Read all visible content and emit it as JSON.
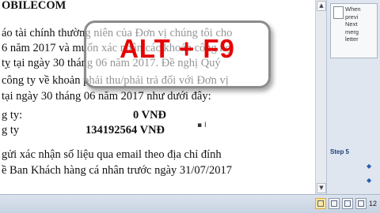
{
  "document": {
    "lines": [
      "OBILECOM",
      "áo tài chính thường niên của Đơn vị chúng tôi cho",
      "6 năm 2017 và muốn xác nhận các khoản công nợ",
      "tỵ tại ngày 30 tháng 06 năm 2017. Đề nghị Quý",
      "công ty về khoản phải thu/phải trả đối với Đơn vị",
      "tại ngày 30 tháng 06 năm 2017 như dưới đây:",
      "g ty:",
      "0  VNĐ",
      "g ty",
      "134192564  VNĐ",
      "gửi  xác nhận số liệu qua email theo địa chỉ đính",
      "ề Ban Khách hàng cá nhân trước ngày 31/07/2017"
    ]
  },
  "overlay": {
    "shortcut": "ALT + F9"
  },
  "task_pane": {
    "preview_text_lines": [
      "When",
      "previ",
      "Next",
      "merg",
      "letter"
    ],
    "step_label": "Step 5"
  },
  "status_bar": {
    "zoom_label": "12"
  },
  "colors": {
    "overlay_text": "#e60000",
    "pane_bg": "#dfe6f0",
    "statusbar_bg": "#c8d3e2"
  }
}
